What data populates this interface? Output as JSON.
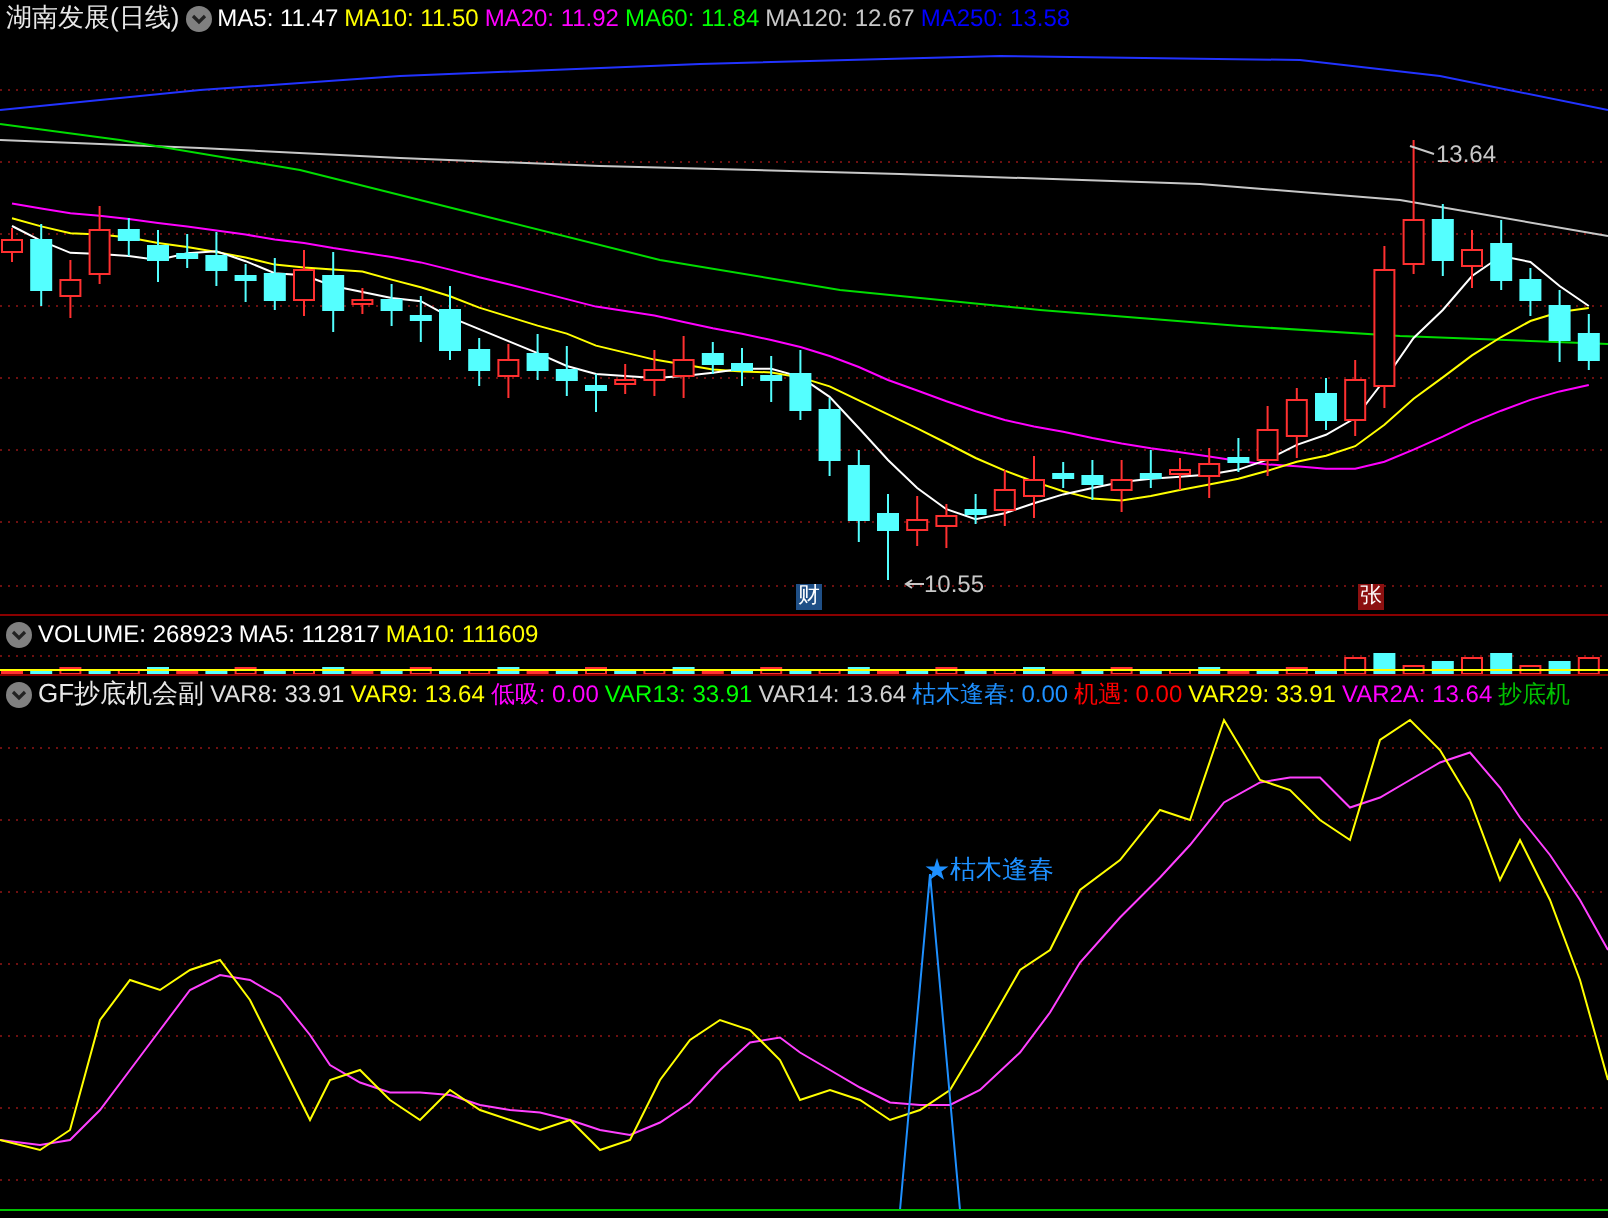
{
  "price_panel": {
    "title": "湖南发展(日线)",
    "indicators": [
      {
        "text": "MA5: 11.47",
        "color": "#ffffff"
      },
      {
        "text": "MA10: 11.50",
        "color": "#ffff00"
      },
      {
        "text": "MA20: 11.92",
        "color": "#ff00ff"
      },
      {
        "text": "MA60: 11.84",
        "color": "#00ff00"
      },
      {
        "text": "MA120: 12.67",
        "color": "#c8c8c8"
      },
      {
        "text": "MA250: 13.58",
        "color": "#0000ff"
      }
    ],
    "high_label": "13.64",
    "low_label": "10.55",
    "markers": [
      {
        "text": "财",
        "color": "#1f4f86"
      },
      {
        "text": "张",
        "color": "#8c1010"
      }
    ]
  },
  "volume_panel": {
    "indicators": [
      {
        "text": "VOLUME: 268923",
        "color": "#ffffff"
      },
      {
        "text": "MA5: 112817",
        "color": "#ffffff"
      },
      {
        "text": "MA10: 111609",
        "color": "#ffff00"
      }
    ]
  },
  "oscillator_panel": {
    "title": "GF抄底机会副",
    "indicators": [
      {
        "text": "VAR8: 33.91",
        "color": "#e0e0e0"
      },
      {
        "text": "VAR9: 13.64",
        "color": "#ffff00"
      },
      {
        "text": "低吸: 0.00",
        "color": "#ff00ff"
      },
      {
        "text": "VAR13: 33.91",
        "color": "#00ff00"
      },
      {
        "text": "VAR14: 13.64",
        "color": "#d0d0d0"
      },
      {
        "text": "枯木逢春: 0.00",
        "color": "#1e90ff"
      },
      {
        "text": "机遇: 0.00",
        "color": "#ff0000"
      },
      {
        "text": "VAR29: 33.91",
        "color": "#ffff00"
      },
      {
        "text": "VAR2A: 13.64",
        "color": "#ff00ff"
      },
      {
        "text": "抄底机",
        "color": "#00c000"
      }
    ],
    "signal_label": "★枯木逢春"
  }
}
